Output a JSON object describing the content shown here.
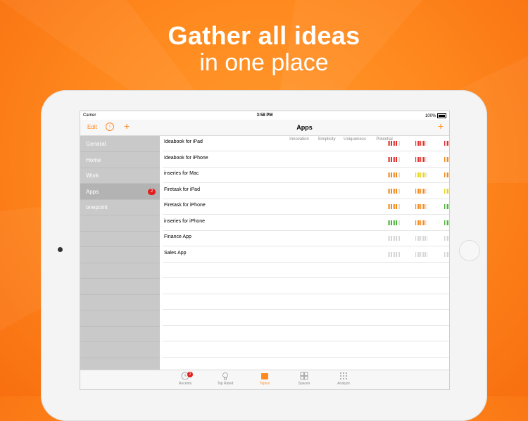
{
  "headline": {
    "line1": "Gather all ideas",
    "line2": "in one place"
  },
  "status_bar": {
    "carrier": "Carrier",
    "time": "3:58 PM",
    "battery": "100%"
  },
  "sidebar": {
    "edit_label": "Edit",
    "info_icon": "info-icon",
    "add_icon": "plus-icon",
    "items": [
      {
        "label": "General",
        "badge": ""
      },
      {
        "label": "Home",
        "badge": ""
      },
      {
        "label": "Work",
        "badge": ""
      },
      {
        "label": "Apps",
        "badge": "2",
        "selected": true
      },
      {
        "label": "onepoint",
        "badge": ""
      }
    ]
  },
  "main": {
    "title": "Apps",
    "columns": [
      "Innovation",
      "Simplicity",
      "Uniqueness",
      "Potential"
    ],
    "rows": [
      {
        "name": "Ideabook for iPad",
        "ratings": [
          "red",
          "red",
          "red",
          "yellow",
          "orange"
        ]
      },
      {
        "name": "Ideabook for iPhone",
        "ratings": [
          "red",
          "red",
          "orange",
          "green",
          "orange"
        ]
      },
      {
        "name": "inseries for Mac",
        "ratings": [
          "orange",
          "yellow",
          "orange",
          "orange",
          "orange"
        ]
      },
      {
        "name": "Firetask for iPad",
        "ratings": [
          "orange",
          "orange",
          "yellow",
          "yellow",
          "orange"
        ]
      },
      {
        "name": "Firetask for iPhone",
        "ratings": [
          "orange",
          "orange",
          "green",
          "green",
          "orange"
        ]
      },
      {
        "name": "inseries for iPhone",
        "ratings": [
          "green",
          "orange",
          "green",
          "green",
          "orange"
        ]
      },
      {
        "name": "Finance App",
        "ratings": [
          "gray",
          "gray",
          "gray",
          "gray",
          ""
        ]
      },
      {
        "name": "Sales App",
        "ratings": [
          "gray",
          "gray",
          "gray",
          "gray",
          ""
        ]
      }
    ]
  },
  "tabbar": {
    "items": [
      {
        "label": "Recents",
        "icon": "clock-icon",
        "badge": "2"
      },
      {
        "label": "Top Rated",
        "icon": "lightbulb-icon",
        "badge": ""
      },
      {
        "label": "Topics",
        "icon": "folder-icon",
        "badge": "",
        "active": true
      },
      {
        "label": "Spaces",
        "icon": "grid-icon",
        "badge": ""
      },
      {
        "label": "Analyze",
        "icon": "dots-icon",
        "badge": ""
      }
    ]
  },
  "colors": {
    "accent": "#ff8a1f",
    "red": "#e0312c",
    "orange": "#f28a1c",
    "yellow": "#e8d31a",
    "green": "#4cb43a",
    "gray": "#d6d6d6"
  }
}
